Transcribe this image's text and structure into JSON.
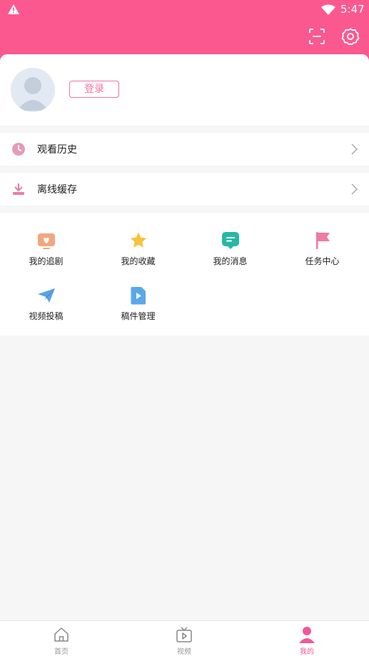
{
  "status_bar": {
    "time": "5:47"
  },
  "profile": {
    "login_label": "登录"
  },
  "menu": {
    "history_label": "观看历史",
    "offline_label": "离线缓存"
  },
  "grid": {
    "items": [
      {
        "label": "我的追剧",
        "icon": "heart-tv-icon"
      },
      {
        "label": "我的收藏",
        "icon": "star-icon"
      },
      {
        "label": "我的消息",
        "icon": "message-icon"
      },
      {
        "label": "任务中心",
        "icon": "flag-icon"
      },
      {
        "label": "视频投稿",
        "icon": "paper-plane-icon"
      },
      {
        "label": "稿件管理",
        "icon": "video-file-icon"
      }
    ]
  },
  "bottom_nav": {
    "items": [
      {
        "label": "首页",
        "icon": "home-icon"
      },
      {
        "label": "视频",
        "icon": "tv-icon"
      },
      {
        "label": "我的",
        "icon": "user-icon"
      }
    ]
  },
  "colors": {
    "brand": "#fb5890",
    "accent_text": "#f0739f",
    "background": "#f6f6f6"
  }
}
